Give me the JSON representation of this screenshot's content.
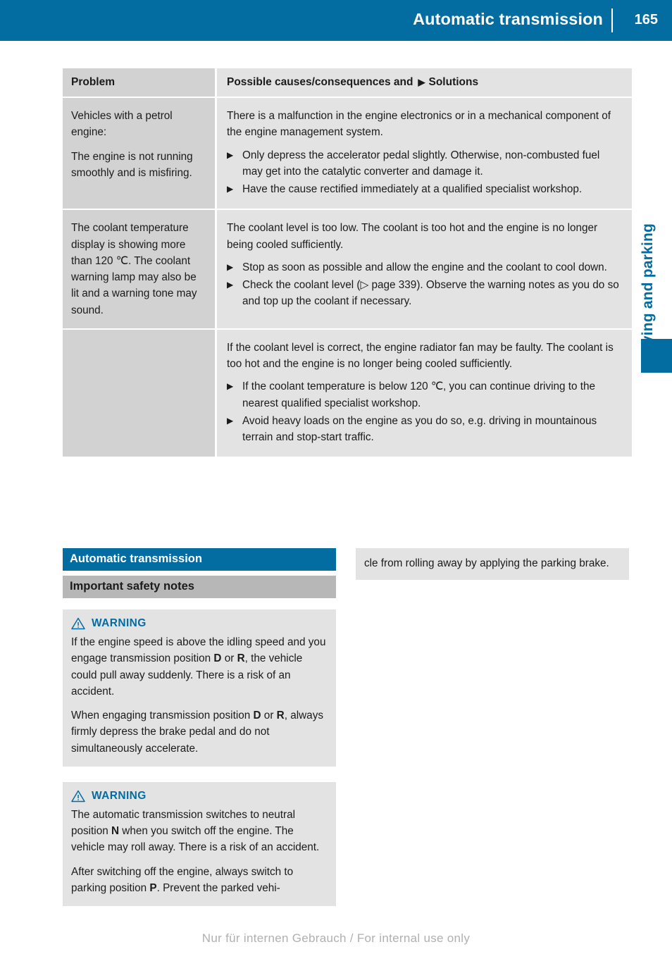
{
  "header": {
    "title": "Automatic transmission",
    "page_number": "165"
  },
  "side_tab": {
    "label": "Driving and parking"
  },
  "table": {
    "columns": {
      "problem": "Problem",
      "causes_prefix": "Possible causes/consequences and",
      "causes_marker": "▶",
      "causes_suffix": "Solutions"
    },
    "rows": [
      {
        "problem_paragraphs": [
          "Vehicles with a petrol engine:",
          "The engine is not running smoothly and is misfiring."
        ],
        "lead": "There is a malfunction in the engine electronics or in a mechanical component of the engine management system.",
        "steps": [
          "Only depress the accelerator pedal slightly. Otherwise, non-combusted fuel may get into the catalytic converter and damage it.",
          "Have the cause rectified immediately at a qualified specialist workshop."
        ]
      },
      {
        "problem_paragraphs": [
          "The coolant temperature display is showing more than 120 ℃. The coolant warning lamp may also be lit and a warning tone may sound."
        ],
        "lead": "The coolant level is too low. The coolant is too hot and the engine is no longer being cooled sufficiently.",
        "steps": [
          "Stop as soon as possible and allow the engine and the coolant to cool down.",
          "Check the coolant level (▷ page 339). Observe the warning notes as you do so and top up the coolant if necessary."
        ]
      },
      {
        "problem_paragraphs": [],
        "lead": "If the coolant level is correct, the engine radiator fan may be faulty. The coolant is too hot and the engine is no longer being cooled sufficiently.",
        "steps": [
          "If the coolant temperature is below 120 ℃, you can continue driving to the nearest qualified specialist workshop.",
          "Avoid heavy loads on the engine as you do so, e.g. driving in mountainous terrain and stop-start traffic."
        ]
      }
    ]
  },
  "section": {
    "title": "Automatic transmission",
    "subtitle": "Important safety notes"
  },
  "warnings": [
    {
      "label": "WARNING",
      "paragraphs_html": [
        "If the engine speed is above the idling speed and you engage transmission position <b>D</b> or <b>R</b>, the vehicle could pull away suddenly. There is a risk of an accident.",
        "When engaging transmission position <b>D</b> or <b>R</b>, always firmly depress the brake pedal and do not simultaneously accelerate."
      ]
    },
    {
      "label": "WARNING",
      "paragraphs_html": [
        "The automatic transmission switches to neutral position <b>N</b> when you switch off the engine. The vehicle may roll away. There is a risk of an accident.",
        "After switching off the engine, always switch to parking position <b>P</b>. Prevent the parked vehi-"
      ]
    }
  ],
  "continuation": {
    "text": "cle from rolling away by applying the parking brake."
  },
  "footer": {
    "text": "Nur für internen Gebrauch / For internal use only"
  },
  "colors": {
    "brand_blue": "#036ca0",
    "header_gray": "#b7b7b7",
    "cell_left_gray": "#d2d2d2",
    "cell_right_gray": "#e3e3e3"
  }
}
